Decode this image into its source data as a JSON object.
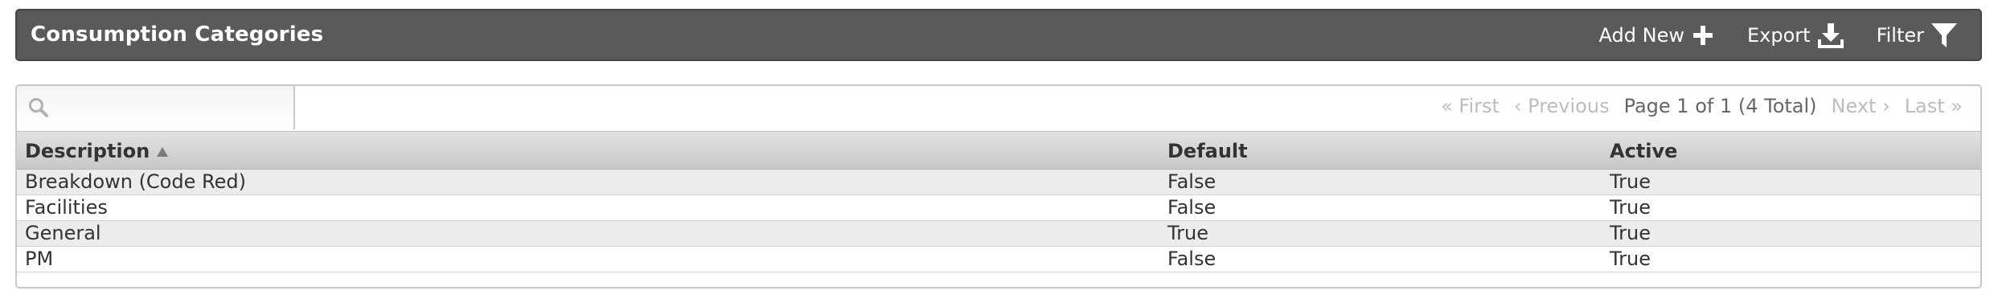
{
  "header": {
    "title": "Consumption Categories",
    "actions": [
      {
        "label": "Add New",
        "icon": "plus-icon"
      },
      {
        "label": "Export",
        "icon": "download-icon"
      },
      {
        "label": "Filter",
        "icon": "filter-icon"
      }
    ]
  },
  "search": {
    "placeholder": "",
    "value": "",
    "icon": "search-icon"
  },
  "pager": {
    "first": "« First",
    "previous": "‹ Previous",
    "info": "Page 1 of 1 (4 Total)",
    "next": "Next ›",
    "last": "Last »"
  },
  "table": {
    "columns": [
      {
        "label": "Description",
        "sort": "ascending"
      },
      {
        "label": "Default"
      },
      {
        "label": "Active"
      }
    ],
    "rows": [
      {
        "description": "Breakdown (Code Red)",
        "default": "False",
        "active": "True"
      },
      {
        "description": "Facilities",
        "default": "False",
        "active": "True"
      },
      {
        "description": "General",
        "default": "True",
        "active": "True"
      },
      {
        "description": "PM",
        "default": "False",
        "active": "True"
      }
    ]
  },
  "colors": {
    "header_bg": "#5a5a5a",
    "row_alt": "#ececec",
    "disabled_text": "#bdbdbd"
  }
}
